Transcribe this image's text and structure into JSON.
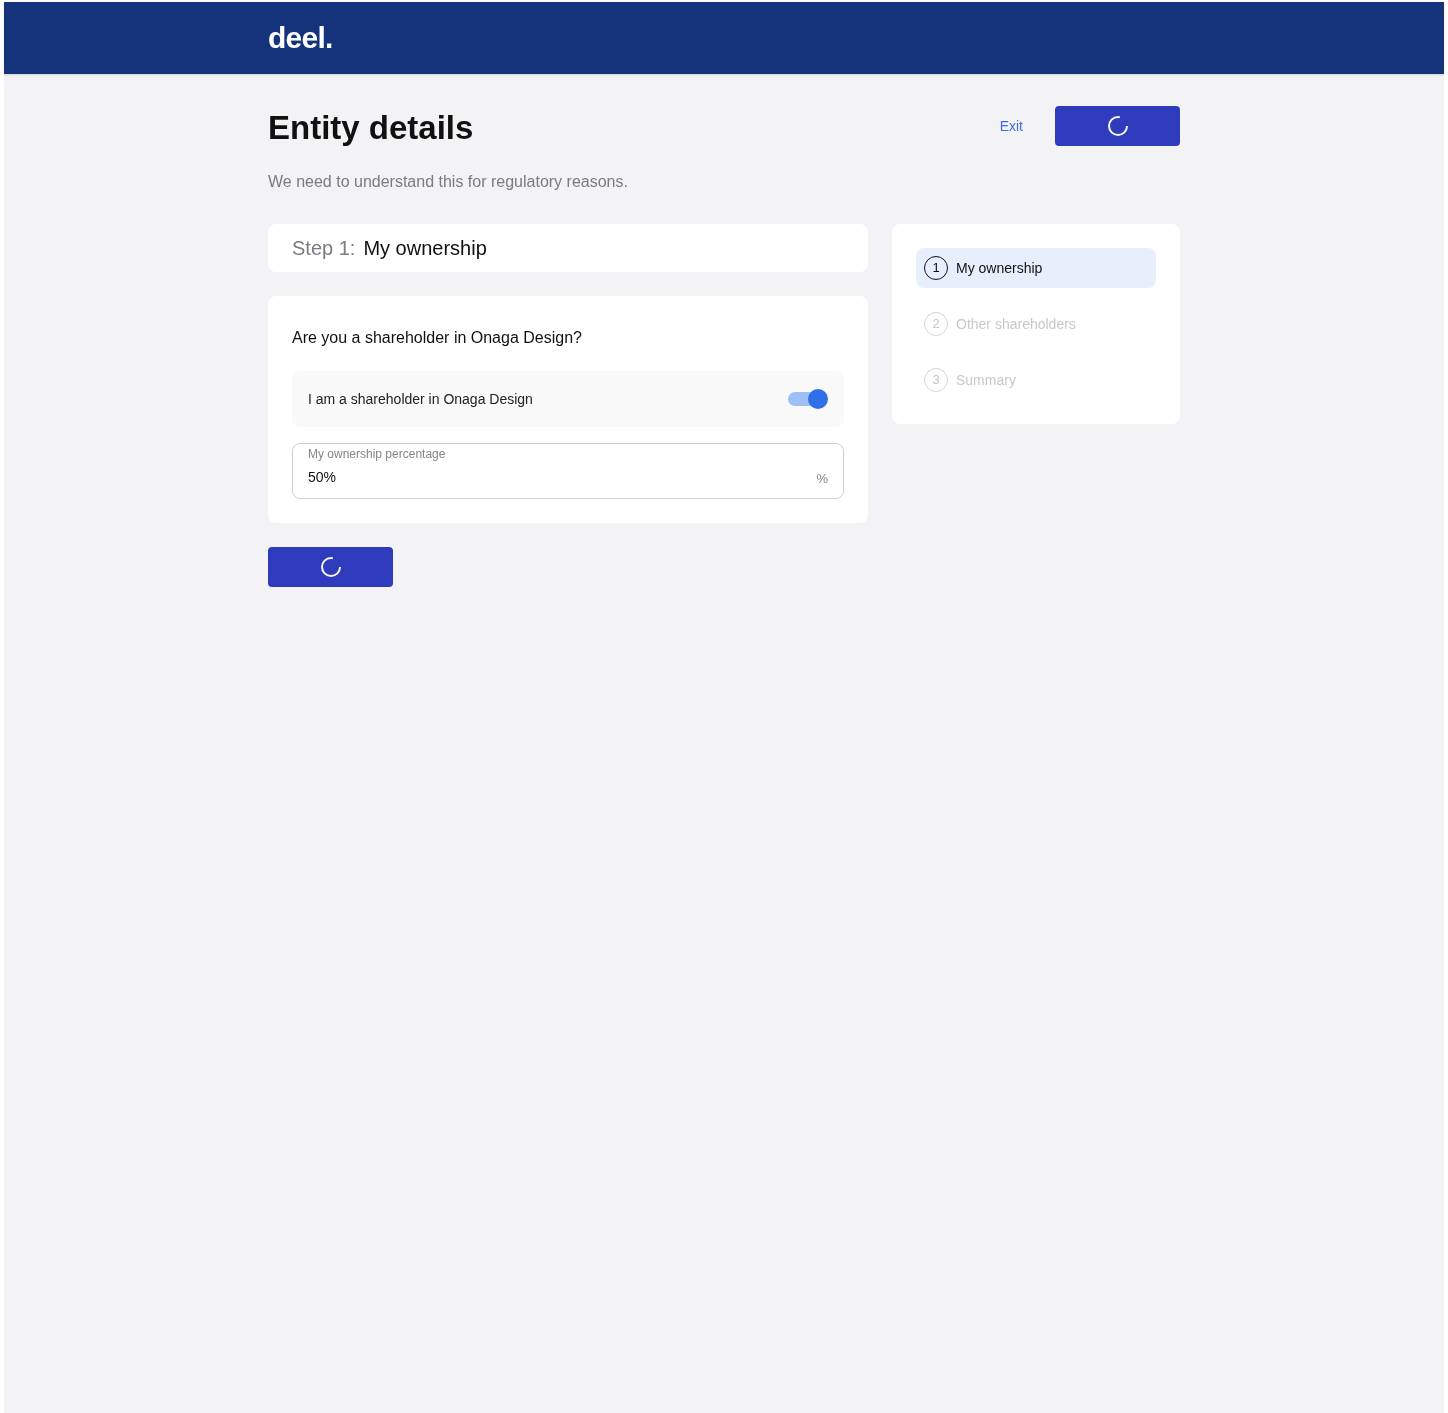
{
  "header": {
    "logo": "deel."
  },
  "page": {
    "title": "Entity details",
    "subtitle": "We need to understand this for regulatory reasons.",
    "exit_link": "Exit",
    "primary_button": {
      "loading": true
    }
  },
  "step_header": {
    "prefix": "Step 1:",
    "title": "My ownership"
  },
  "question": {
    "title": "Are you a shareholder in Onaga Design?",
    "toggle": {
      "label": "I am a shareholder in Onaga Design",
      "on": true
    },
    "field": {
      "label": "My ownership percentage",
      "value": "50%",
      "suffix": "%"
    }
  },
  "continue_button": {
    "loading": true
  },
  "steps": [
    {
      "number": "1",
      "label": "My ownership",
      "selected": true
    },
    {
      "number": "2",
      "label": "Other shareholders",
      "selected": false
    },
    {
      "number": "3",
      "label": "Summary",
      "selected": false
    }
  ]
}
